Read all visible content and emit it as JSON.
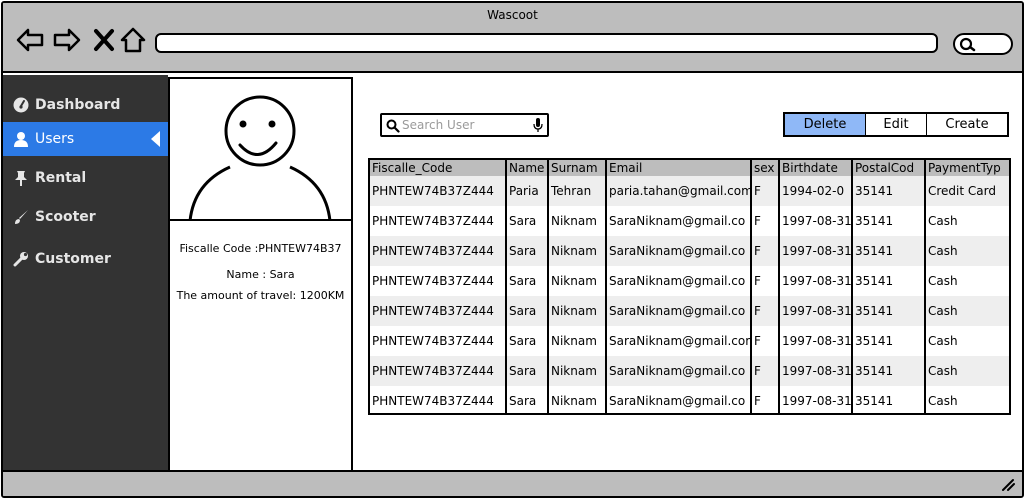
{
  "window": {
    "title": "Wascoot"
  },
  "sidebar": {
    "items": [
      {
        "label": "Dashboard",
        "icon": "dashboard-icon"
      },
      {
        "label": "Users",
        "icon": "user-icon",
        "active": true
      },
      {
        "label": "Rental",
        "icon": "pin-icon"
      },
      {
        "label": "Scooter",
        "icon": "brush-icon"
      },
      {
        "label": "Customer",
        "icon": "wrench-icon"
      }
    ]
  },
  "profile": {
    "fiscal_code": "Fiscalle Code :PHNTEW74B37",
    "name": "Name : Sara",
    "travel": "The amount of travel: 1200KM"
  },
  "search": {
    "placeholder": "Search User"
  },
  "actions": {
    "delete": "Delete",
    "edit": "Edit",
    "create": "Create"
  },
  "table": {
    "headers": [
      "Fiscalle_Code",
      "Name",
      "Surnam",
      "Email",
      "sex",
      "Birthdate",
      "PostalCod",
      "PaymentTyp"
    ],
    "rows": [
      [
        "PHNTEW74B37Z444",
        "Paria",
        "Tehran",
        "paria.tahan@gmail.com",
        "F",
        "1994-02-0",
        "35141",
        "Credit Card"
      ],
      [
        "PHNTEW74B37Z444",
        "Sara",
        "Niknam",
        "SaraNiknam@gmail.co",
        "F",
        "1997-08-31",
        "35141",
        "Cash"
      ],
      [
        "PHNTEW74B37Z444",
        "Sara",
        "Niknam",
        "SaraNiknam@gmail.co",
        "F",
        "1997-08-31",
        "35141",
        "Cash"
      ],
      [
        "PHNTEW74B37Z444",
        "Sara",
        "Niknam",
        "SaraNiknam@gmail.co",
        "F",
        "1997-08-31",
        "35141",
        "Cash"
      ],
      [
        "PHNTEW74B37Z444",
        "Sara",
        "Niknam",
        "SaraNiknam@gmail.co",
        "F",
        "1997-08-31",
        "35141",
        "Cash"
      ],
      [
        "PHNTEW74B37Z444",
        "Sara",
        "Niknam",
        "SaraNiknam@gmail.com",
        "F",
        "1997-08-31",
        "35141",
        "Cash"
      ],
      [
        "PHNTEW74B37Z444",
        "Sara",
        "Niknam",
        "SaraNiknam@gmail.co",
        "F",
        "1997-08-31",
        "35141",
        "Cash"
      ],
      [
        "PHNTEW74B37Z444",
        "Sara",
        "Niknam",
        "SaraNiknam@gmail.co",
        "F",
        "1997-08-31",
        "35141",
        "Cash"
      ]
    ]
  },
  "colors": {
    "sidebar_bg": "#333333",
    "active": "#2c7ae6",
    "primary_button": "#8fb8f7",
    "chrome": "#bdbdbd"
  }
}
